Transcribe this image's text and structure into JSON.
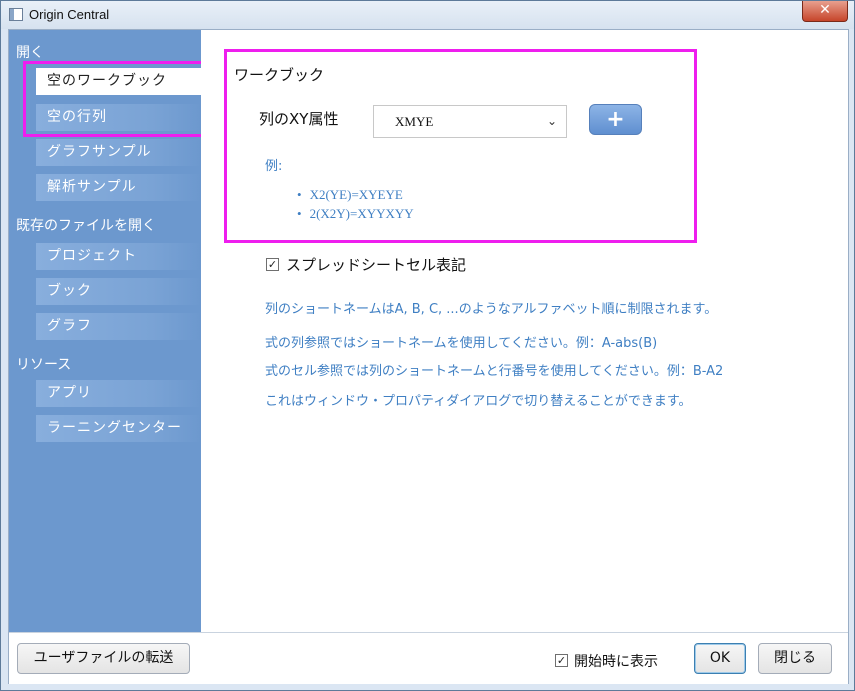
{
  "window": {
    "title": "Origin Central",
    "close_glyph": "✕"
  },
  "sidebar": {
    "open_header": "開く",
    "open_items": [
      {
        "label": "空のワークブック",
        "selected": true
      },
      {
        "label": "空の行列"
      },
      {
        "label": "グラフサンプル"
      },
      {
        "label": "解析サンプル"
      }
    ],
    "existing_header": "既存のファイルを開く",
    "existing_items": [
      {
        "label": "プロジェクト"
      },
      {
        "label": "ブック"
      },
      {
        "label": "グラフ"
      }
    ],
    "resources_header": "リソース",
    "resources_items": [
      {
        "label": "アプリ"
      },
      {
        "label": "ラーニングセンター"
      }
    ]
  },
  "main": {
    "section_title": "ワークブック",
    "xy_label": "列のXY属性",
    "xy_select": {
      "value": "XMYE",
      "chevron": "⌄"
    },
    "add_button": "+",
    "example_label": "例:",
    "examples": [
      "X2(YE)=XYEYE",
      "2(X2Y)=XYYXYY"
    ],
    "spreadsheet_checkbox": {
      "label": "スプレッドシートセル表記",
      "checked": true
    },
    "info_lines": [
      "列のショートネームはA, B, C, ...のようなアルファベット順に制限されます。",
      "式の列参照ではショートネームを使用してください。例：A-abs(B)",
      "式のセル参照では列のショートネームと行番号を使用してください。例：B-A2",
      "これはウィンドウ・プロパティダイアログで切り替えることができます。"
    ]
  },
  "footer": {
    "transfer_button": "ユーザファイルの転送",
    "show_on_start": {
      "label": "開始時に表示",
      "checked": true
    },
    "ok_button": "OK",
    "close_button": "閉じる"
  },
  "colors": {
    "sidebar": "#6c98ce",
    "highlight": "#ee1eee",
    "info_text": "#3f7fc3"
  },
  "icons": [
    "app-icon",
    "close-icon",
    "chevron-down-icon",
    "plus-icon",
    "checkmark-icon"
  ]
}
